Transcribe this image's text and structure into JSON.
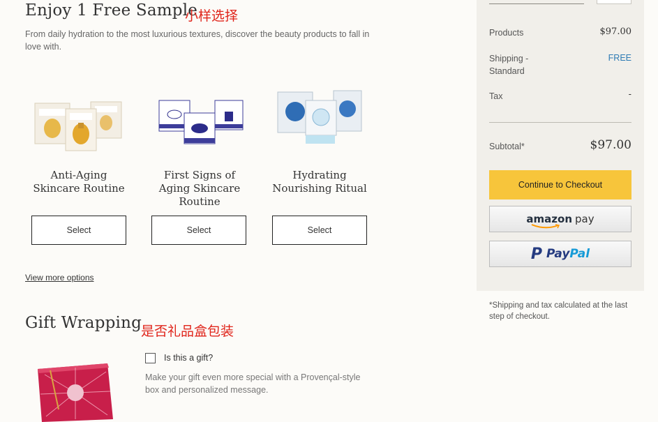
{
  "samples": {
    "title": "Enjoy 1 Free Sample",
    "annotation": "小样选择",
    "subtitle": "From daily hydration to the most luxurious textures, discover the beauty products to fall in love with.",
    "items": [
      {
        "name": "Anti-Aging Skincare Routine",
        "button": "Select"
      },
      {
        "name": "First Signs of Aging Skincare Routine",
        "button": "Select"
      },
      {
        "name": "Hydrating Nourishing Ritual",
        "button": "Select"
      }
    ],
    "view_more": "View more options"
  },
  "gift": {
    "title": "Gift Wrapping",
    "annotation": "是否礼品盒包装",
    "checkbox_label": "Is this a gift?",
    "checked": false,
    "description": "Make your gift even more special with a Provençal-style box and personalized message."
  },
  "summary": {
    "products_label": "Products",
    "products_value": "$97.00",
    "shipping_label": "Shipping - Standard",
    "shipping_value": "FREE",
    "tax_label": "Tax",
    "tax_value": "-",
    "subtotal_label": "Subtotal*",
    "subtotal_value": "$97.00",
    "checkout_button": "Continue to Checkout",
    "amazon_pay": {
      "word1": "amazon",
      "word2": "pay"
    },
    "paypal": {
      "word1": "Pay",
      "word2": "Pal",
      "mark": "P"
    },
    "footnote": "*Shipping and tax calculated at the last step of checkout."
  },
  "colors": {
    "accent": "#f7c53b",
    "free": "#2e7bb4",
    "annotation": "#e0251b",
    "paypal_dark": "#253b80",
    "paypal_light": "#179bd7"
  }
}
